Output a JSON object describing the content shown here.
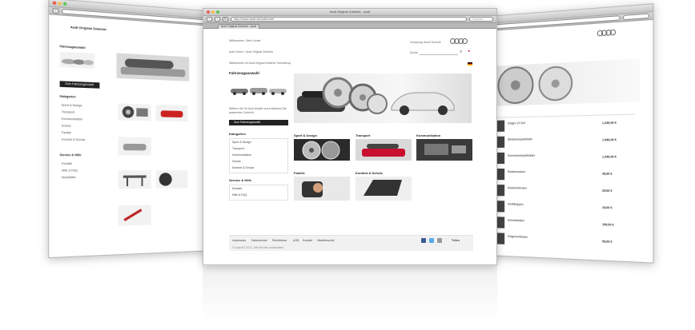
{
  "colors": {
    "page_background": "#ffffff",
    "dark_button": "#222222",
    "accent_red": "#c8102e"
  },
  "main_window": {
    "title": "Audi Original Zubehör - Audi",
    "url": "http://www.audi.de/zubehoer",
    "search_placeholder": "Suchen",
    "tab_label": "Audi Original Zubehör - Audi",
    "header": {
      "greeting": "Willkommen, Sehr Kunde",
      "breadcrumb": "Audi Home > Audi Original Zubehör",
      "brand_line": "Vorsprung durch Technik",
      "search_label": "Suche"
    },
    "intro_line": "Willkommen im Audi Original Zubehör Onlineshop",
    "hero": {
      "heading": "Fahrzeugauswahl",
      "description": "Wählen Sie Ihr Audi Modell und entdecken Sie passendes Zubehör.",
      "button_label": "Zum Fahrzeugmodell"
    },
    "sidebar": {
      "heading_1": "Kategorien",
      "items_1": [
        "Sport & Design",
        "Transport",
        "Kommunikation",
        "Schutz",
        "Komfort & Schutz"
      ],
      "heading_2": "Service & Hilfe",
      "items_2": [
        "Kontakt",
        "Hilfe & FAQ"
      ]
    },
    "tiles": [
      {
        "title": "Sport & Design"
      },
      {
        "title": "Transport"
      },
      {
        "title": "Kommunikation"
      },
      {
        "title": "Familie"
      },
      {
        "title": "Komfort & Schutz"
      }
    ],
    "footer": {
      "links": [
        "Impressum",
        "Datenschutz",
        "Rechtliches",
        "AGB",
        "Kontakt",
        "Händlersuche"
      ],
      "copyright": "© Audi AG 2012. Alle Rechte vorbehalten.",
      "share_label": "Teilen"
    }
  },
  "left_window": {
    "rows": [
      "Audi Original Zubehör",
      "Fahrzeugauswahl",
      "Kategorien",
      "Sport & Design",
      "Transport",
      "Kommunikation",
      "Schutz",
      "Familie",
      "Komfort & Schutz",
      "Service & Hilfe",
      "Kontakt",
      "Hilfe & FAQ",
      "Newsletter"
    ],
    "button_label": "Zum Fahrzeugmodell"
  },
  "right_window": {
    "rows": [
      "Felgen 19 Zoll",
      "Winterkompletträder",
      "Sommerkompletträder",
      "Radschrauben",
      "Radzierblenden",
      "Ventilkappen",
      "Schneeketten",
      "Felgenschlösser"
    ],
    "prices": [
      "1.249,00 €",
      "1.549,00 €",
      "1.349,00 €",
      "49,00 €",
      "29,00 €",
      "19,00 €",
      "199,00 €",
      "59,00 €"
    ]
  }
}
